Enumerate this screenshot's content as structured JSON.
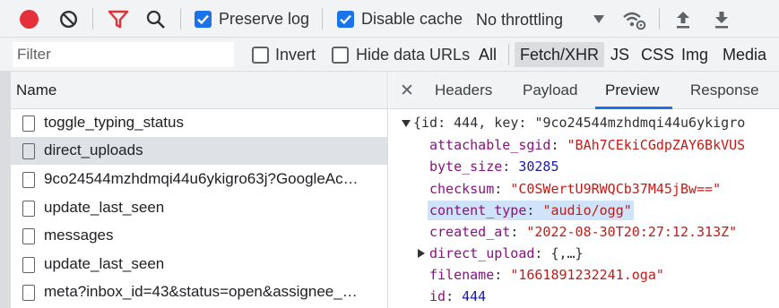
{
  "toolbar": {
    "preserve_log": {
      "label": "Preserve log",
      "checked": true
    },
    "disable_cache": {
      "label": "Disable cache",
      "checked": true
    },
    "throttling": "No throttling",
    "icons": [
      "record-icon",
      "clear-icon",
      "filter-icon",
      "search-icon",
      "network-conditions-icon",
      "import-har-icon",
      "export-har-icon"
    ]
  },
  "filter_bar": {
    "placeholder": "Filter",
    "invert_label": "Invert",
    "hide_data_urls_label": "Hide data URLs",
    "types": [
      "All",
      "Fetch/XHR",
      "JS",
      "CSS",
      "Img",
      "Media"
    ],
    "active_type": "Fetch/XHR"
  },
  "requests": {
    "column_header": "Name",
    "rows": [
      {
        "name": "toggle_typing_status",
        "selected": false
      },
      {
        "name": "direct_uploads",
        "selected": true
      },
      {
        "name": "9co24544mzhdmqi44u6ykigro63j?GoogleAc…",
        "selected": false
      },
      {
        "name": "update_last_seen",
        "selected": false
      },
      {
        "name": "messages",
        "selected": false
      },
      {
        "name": "update_last_seen",
        "selected": false
      },
      {
        "name": "meta?inbox_id=43&status=open&assignee_…",
        "selected": false
      }
    ]
  },
  "detail": {
    "close_symbol": "✕",
    "tabs": [
      "Headers",
      "Payload",
      "Preview",
      "Response"
    ],
    "active_tab": "Preview",
    "preview": {
      "root_open": "{id: 444, key: \"9co24544mzhdmqi44u6ykigro",
      "fields": [
        {
          "key": "attachable_sgid",
          "value": "\"BAh7CEkiCGdpZAY6BkVUS",
          "kind": "string"
        },
        {
          "key": "byte_size",
          "value": "30285",
          "kind": "number"
        },
        {
          "key": "checksum",
          "value": "\"C0SWertU9RWQCb37M45jBw==\"",
          "kind": "string"
        },
        {
          "key": "content_type",
          "value": "\"audio/ogg\"",
          "kind": "string",
          "highlighted": true
        },
        {
          "key": "created_at",
          "value": "\"2022-08-30T20:27:12.313Z\"",
          "kind": "string"
        },
        {
          "key": "direct_upload",
          "value": "{,…}",
          "kind": "object",
          "expandable": true
        },
        {
          "key": "filename",
          "value": "\"1661891232241.oga\"",
          "kind": "string"
        },
        {
          "key": "id",
          "value": "444",
          "kind": "number"
        }
      ]
    }
  },
  "colors": {
    "record": "#e5303a",
    "accent": "#1a73e8",
    "toolbar_bg": "#f1f3f4",
    "selected_row": "#dee1e5",
    "json_key": "#881280",
    "json_string": "#c41a16",
    "json_number": "#1a1aa6",
    "highlight": "#cfe3fa"
  }
}
